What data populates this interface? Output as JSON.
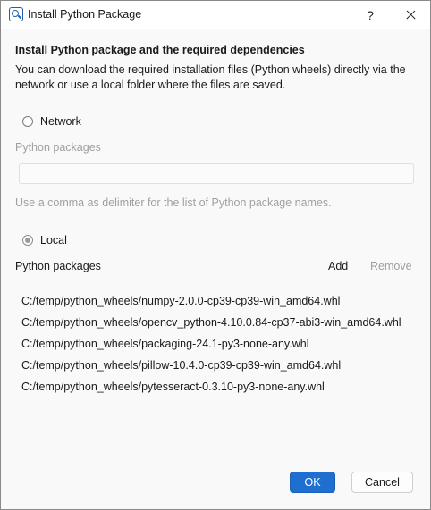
{
  "window": {
    "title": "Install Python Package",
    "help_label": "?",
    "app_icon": "python-install-icon",
    "close_icon": "close-icon"
  },
  "heading": "Install Python package and the required dependencies",
  "description": "You can download the required installation files (Python wheels) directly via the network or use a local folder where the files are saved.",
  "network": {
    "radio_label": "Network",
    "selected": false,
    "packages_label": "Python packages",
    "input_value": "",
    "hint": "Use a comma as delimiter for the list of Python package names."
  },
  "local": {
    "radio_label": "Local",
    "selected": true,
    "packages_label": "Python packages",
    "add_label": "Add",
    "remove_label": "Remove",
    "files": [
      "C:/temp/python_wheels/numpy-2.0.0-cp39-cp39-win_amd64.whl",
      "C:/temp/python_wheels/opencv_python-4.10.0.84-cp37-abi3-win_amd64.whl",
      "C:/temp/python_wheels/packaging-24.1-py3-none-any.whl",
      "C:/temp/python_wheels/pillow-10.4.0-cp39-cp39-win_amd64.whl",
      "C:/temp/python_wheels/pytesseract-0.3.10-py3-none-any.whl"
    ]
  },
  "buttons": {
    "ok_label": "OK",
    "cancel_label": "Cancel"
  },
  "colors": {
    "accent": "#1f6fd1",
    "disabled_text": "#a0a0a0"
  }
}
